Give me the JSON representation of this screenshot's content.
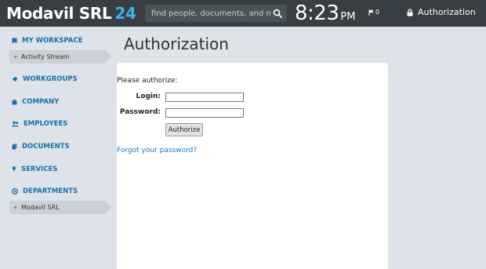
{
  "header": {
    "logo_text": "Modavil SRL",
    "logo_number": "24",
    "search_placeholder": "find people, documents, and more",
    "clock_time": "8:23",
    "clock_ampm": "PM",
    "flag_count": "0",
    "auth_label": "Authorization"
  },
  "sidebar": {
    "my_workspace": "MY WORKSPACE",
    "activity_stream": "Activity Stream",
    "workgroups": "WORKGROUPS",
    "company": "COMPANY",
    "employees": "EMPLOYEES",
    "documents": "DOCUMENTS",
    "services": "SERVICES",
    "departments": "DEPARTMENTS",
    "department_item": "Modavil SRL"
  },
  "main": {
    "title": "Authorization",
    "prompt": "Please authorize:",
    "login_label": "Login:",
    "password_label": "Password:",
    "login_value": "",
    "password_value": "",
    "submit_label": "Authorize",
    "forgot_link": "Forgot your password?"
  },
  "colors": {
    "header_bg": "#373f44",
    "accent": "#3fb2e6",
    "sidebar_link": "#1b6fa8",
    "page_bg": "#dde3e8"
  }
}
